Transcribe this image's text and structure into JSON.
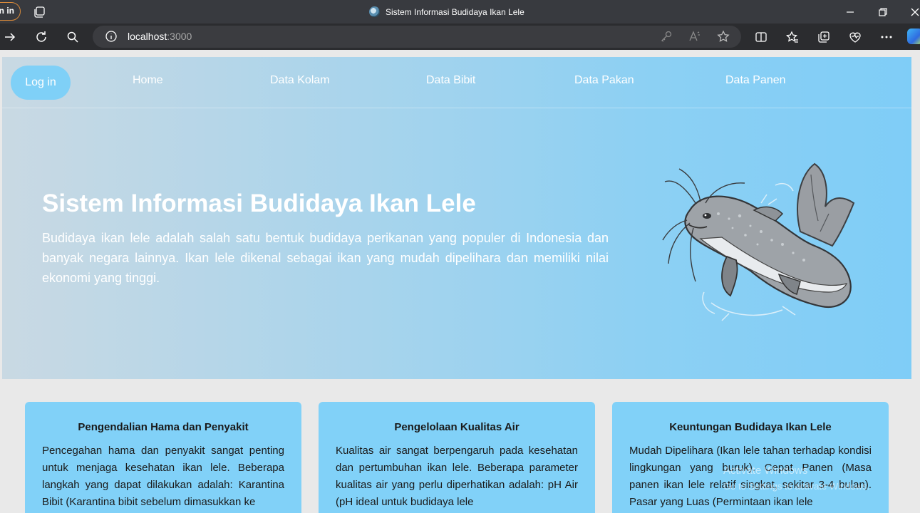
{
  "browser": {
    "profile_label": "n in",
    "tab_title": "Sistem Informasi Budidaya Ikan Lele",
    "url_host": "localhost",
    "url_port": ":3000"
  },
  "nav": {
    "login": "Log in",
    "links": [
      "Home",
      "Data Kolam",
      "Data Bibit",
      "Data Pakan",
      "Data Panen"
    ]
  },
  "hero": {
    "title": "Sistem Informasi Budidaya Ikan Lele",
    "description": "Budidaya ikan lele adalah salah satu bentuk budidaya perikanan yang populer di Indonesia dan banyak negara lainnya. Ikan lele dikenal sebagai ikan yang mudah dipelihara dan memiliki nilai ekonomi yang tinggi."
  },
  "cards": [
    {
      "title": "Pengendalian Hama dan Penyakit",
      "text": "Pencegahan hama dan penyakit sangat penting untuk menjaga kesehatan ikan lele. Beberapa langkah yang dapat dilakukan adalah: Karantina Bibit (Karantina bibit sebelum dimasukkan ke"
    },
    {
      "title": "Pengelolaan Kualitas Air",
      "text": "Kualitas air sangat berpengaruh pada kesehatan dan pertumbuhan ikan lele. Beberapa parameter kualitas air yang perlu diperhatikan adalah: pH Air (pH ideal untuk budidaya lele"
    },
    {
      "title": "Keuntungan Budidaya Ikan Lele",
      "text": "Mudah Dipelihara (Ikan lele tahan terhadap kondisi lingkungan yang buruk). Cepat Panen (Masa panen ikan lele relatif singkat, sekitar 3-4 bulan). Pasar yang Luas (Permintaan ikan lele"
    }
  ],
  "watermark": {
    "line1": "Activate Windows",
    "line2": "Go to Settings to activate Windows."
  },
  "colors": {
    "chrome_titlebar": "#383a3f",
    "chrome_toolbar": "#2b2c2f",
    "hero_left": "#c9d9e3",
    "hero_right": "#7fcdf7",
    "card": "#81d1f8",
    "login_button": "#7fd0f7"
  },
  "icons": [
    "tab-actions-icon",
    "minimize-icon",
    "restore-icon",
    "close-icon",
    "forward-icon",
    "refresh-icon",
    "search-icon",
    "site-info-icon",
    "key-icon",
    "read-aloud-icon",
    "favorite-star-icon",
    "split-screen-icon",
    "favorites-icon",
    "collections-icon",
    "browser-essentials-icon",
    "more-icon",
    "catfish-illustration"
  ]
}
